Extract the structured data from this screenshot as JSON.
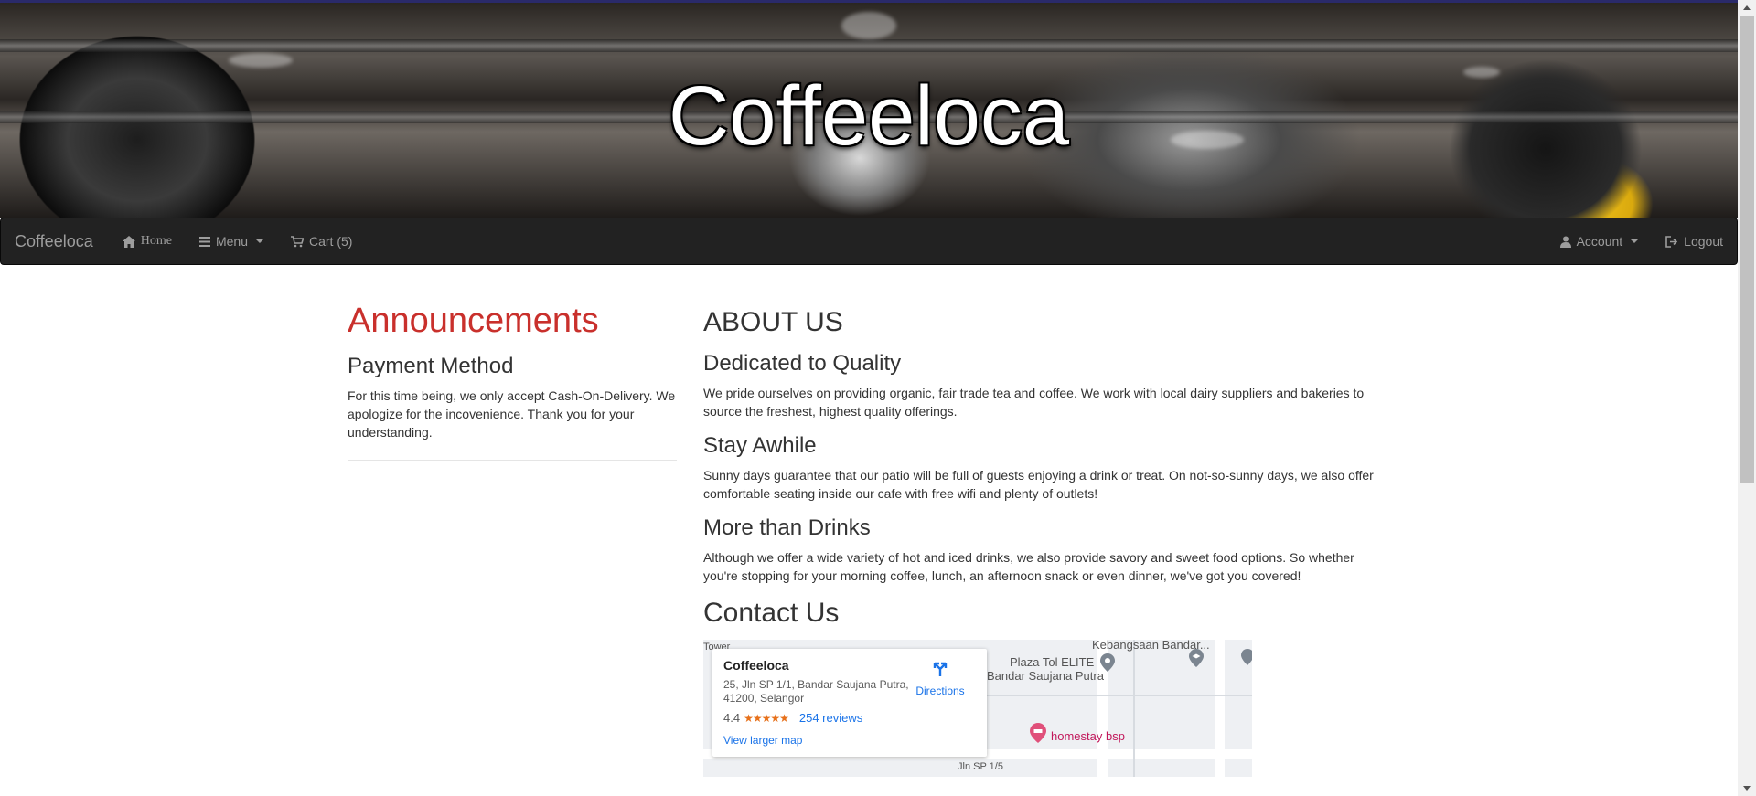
{
  "banner": {
    "title": "Coffeeloca"
  },
  "navbar": {
    "brand": "Coffeeloca",
    "home": "Home",
    "menu": "Menu",
    "cart": "Cart (5)",
    "account": "Account",
    "logout": "Logout"
  },
  "announcements": {
    "title": "Announcements",
    "items": [
      {
        "title": "Payment Method",
        "text": "For this time being, we only accept Cash-On-Delivery. We apologize for the incovenience. Thank you for your understanding."
      }
    ]
  },
  "about": {
    "title": "ABOUT US",
    "sections": [
      {
        "title": "Dedicated to Quality",
        "text": "We pride ourselves on providing organic, fair trade tea and coffee. We work with local dairy suppliers and bakeries to source the freshest, highest quality offerings."
      },
      {
        "title": "Stay Awhile",
        "text": "Sunny days guarantee that our patio will be full of guests enjoying a drink or treat. On not-so-sunny days, we also offer comfortable seating inside our cafe with free wifi and plenty of outlets!"
      },
      {
        "title": "More than Drinks",
        "text": "Although we offer a wide variety of hot and iced drinks, we also provide savory and sweet food options. So whether you're stopping for your morning coffee, lunch, an afternoon snack or even dinner, we've got you covered!"
      }
    ],
    "contact_title": "Contact Us"
  },
  "map": {
    "place_name": "Coffeeloca",
    "address": "25, Jln SP 1/1, Bandar Saujana Putra, 41200, Selangor",
    "rating": "4.4",
    "stars": "★★★★★",
    "reviews": "254 reviews",
    "directions": "Directions",
    "larger_map": "View larger map",
    "labels": {
      "top_left": "Tower",
      "top_right": "Kebangsaan Bandar...",
      "plaza": "Plaza Tol ELITE",
      "bandar": "Bandar Saujana Putra",
      "homestay": "homestay bsp",
      "road": "Jln SP 1/5"
    },
    "colors": {
      "pin_pink": "#e0507a",
      "pin_grey": "#7b8590",
      "link": "#1a73e8",
      "stars": "#e7711b"
    }
  },
  "colors": {
    "navbar_bg": "#222222",
    "nav_text": "#9d9d9d",
    "announcement_red": "#c9302c"
  }
}
